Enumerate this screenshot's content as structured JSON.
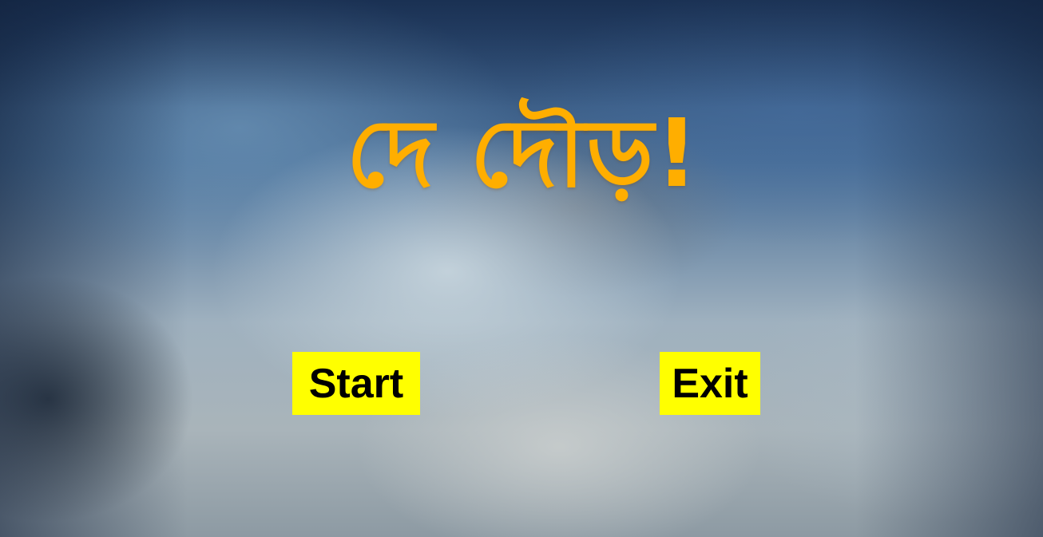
{
  "game": {
    "title": "দে দৌড়!",
    "title_color": "#ffae00"
  },
  "menu": {
    "start_label": "Start",
    "exit_label": "Exit",
    "button_color": "#ffff00",
    "button_text_color": "#000000"
  }
}
